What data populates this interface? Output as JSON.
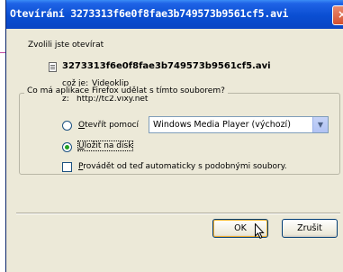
{
  "window": {
    "title": "Otevírání 3273313f6e0f8fae3b749573b9561cf5.avi",
    "close_glyph": "×"
  },
  "dialog": {
    "intro": "Zvolili jste otevírat",
    "filename": "3273313f6e0f8fae3b749573b9561cf5.avi",
    "type_label": "což je:",
    "type_value": "Videoklip",
    "from_label": "z:",
    "from_value": "http://tc2.vixy.net",
    "group_title": "Co má aplikace Firefox udělat s tímto souborem?",
    "open_with_label_first": "O",
    "open_with_label_rest": "tevřít pomocí",
    "open_with_selected": false,
    "app_select_value": "Windows Media Player (výchozí)",
    "save_label_first": "U",
    "save_label_rest": "ložit na disk",
    "save_selected": true,
    "auto_label_first": "P",
    "auto_label_rest": "rovádět od teď automaticky s podobnými soubory.",
    "auto_checked": false
  },
  "buttons": {
    "ok": "OK",
    "cancel": "Zrušit"
  },
  "icons": {
    "file": "video-file-icon",
    "dropdown": "chevron-down-icon",
    "cursor": "mouse-pointer-icon"
  }
}
